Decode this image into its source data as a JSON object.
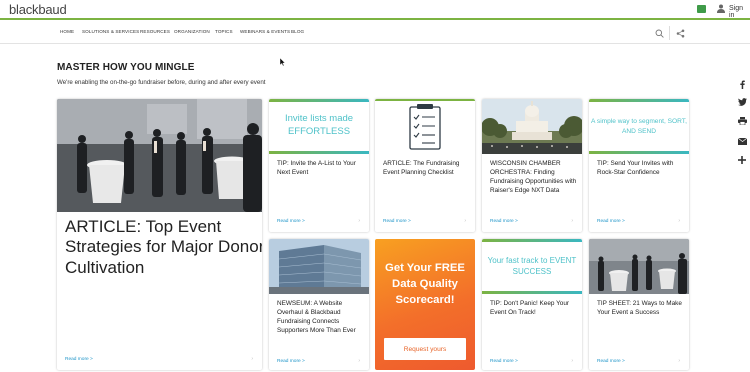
{
  "header": {
    "logo": "blackbaud",
    "signin_label": "Sign in",
    "icons": [
      "mail-icon",
      "user-icon"
    ]
  },
  "nav": {
    "items": [
      "HOME",
      "SOLUTIONS & SERVICES",
      "RESOURCES",
      "ORGANIZATION",
      "TOPICS",
      "WEBINARS & EVENTS",
      "BLOG"
    ],
    "icons": [
      "search-icon",
      "share-icon"
    ]
  },
  "page": {
    "title": "MASTER HOW YOU MINGLE",
    "subtitle": "We're enabling the on-the-go fundraiser before, during and after every event"
  },
  "social": [
    "facebook-icon",
    "twitter-icon",
    "print-icon",
    "email-icon",
    "plus-icon"
  ],
  "colors": {
    "accent_green": "#7cb342",
    "link_blue": "#2196c9",
    "promo_orange": "#f36f2a",
    "teal": "#4fc2c9"
  },
  "featured": {
    "title": "ARTICLE: Top Event Strategies for Major Donor Cultivation",
    "read_more": "Read more >"
  },
  "cards": [
    {
      "banner": "Invite lists made EFFORTLESS",
      "title": "TIP: Invite the A-List to Your Next Event",
      "read_more": "Read more >"
    },
    {
      "title": "ARTICLE: The Fundraising Event Planning Checklist",
      "read_more": "Read more >"
    },
    {
      "title": "WISCONSIN CHAMBER ORCHESTRA: Finding Fundraising Opportunities with Raiser's Edge NXT Data",
      "read_more": "Read more >"
    },
    {
      "banner": "A simple way to segment, SORT, AND SEND",
      "title": "TIP: Send Your Invites with Rock-Star Confidence",
      "read_more": "Read more >"
    },
    {
      "title": "NEWSEUM: A Website Overhaul & Blackbaud Fundraising Connects Supporters More Than Ever",
      "read_more": "Read more >"
    },
    {
      "banner": "Your fast track to EVENT SUCCESS",
      "title": "TIP: Don't Panic! Keep Your Event On Track!",
      "read_more": "Read more >"
    },
    {
      "title": "TIP SHEET: 21 Ways to Make Your Event a Success",
      "read_more": "Read more >"
    }
  ],
  "promo": {
    "text": "Get Your FREE Data Quality Scorecard!",
    "button": "Request yours"
  }
}
